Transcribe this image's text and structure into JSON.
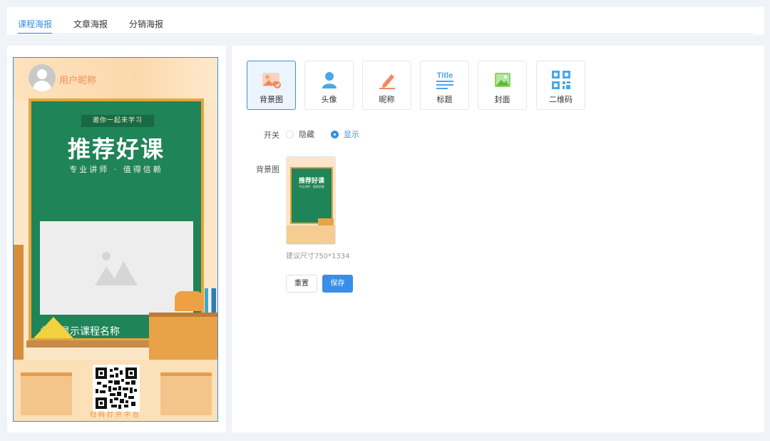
{
  "tabs": {
    "items": [
      {
        "label": "课程海报",
        "active": true
      },
      {
        "label": "文章海报",
        "active": false
      },
      {
        "label": "分销海报",
        "active": false
      }
    ]
  },
  "poster": {
    "nickname": "用户昵称",
    "invite": "邀你一起来学习",
    "headline": "推荐好课",
    "subline": "专业讲师 · 值得信赖",
    "course_name": "此处显示课程名称",
    "scan_text": "扫码打开平台",
    "cover_icon": "image-placeholder-icon",
    "qr_icon": "qr-code-icon"
  },
  "toolbar": {
    "items": [
      {
        "label": "背景图",
        "icon": "background-image-icon",
        "active": true
      },
      {
        "label": "头像",
        "icon": "avatar-icon",
        "active": false
      },
      {
        "label": "昵称",
        "icon": "nickname-pen-icon",
        "active": false
      },
      {
        "label": "标题",
        "icon": "title-icon",
        "icon_text": "Title",
        "active": false
      },
      {
        "label": "封面",
        "icon": "cover-image-icon",
        "active": false
      },
      {
        "label": "二维码",
        "icon": "qr-code-icon",
        "active": false
      }
    ]
  },
  "form": {
    "switch_label": "开关",
    "options": [
      {
        "label": "隐藏",
        "checked": false
      },
      {
        "label": "显示",
        "checked": true
      }
    ],
    "bg_label": "背景图",
    "thumb_title": "推荐好课",
    "thumb_sub": "专业讲师 · 值得信赖",
    "hint": "建议尺寸750*1334",
    "reset_label": "重置",
    "save_label": "保存"
  },
  "colors": {
    "accent": "#3a8ee6",
    "board": "#1f8457",
    "frame": "#e6a53a"
  }
}
